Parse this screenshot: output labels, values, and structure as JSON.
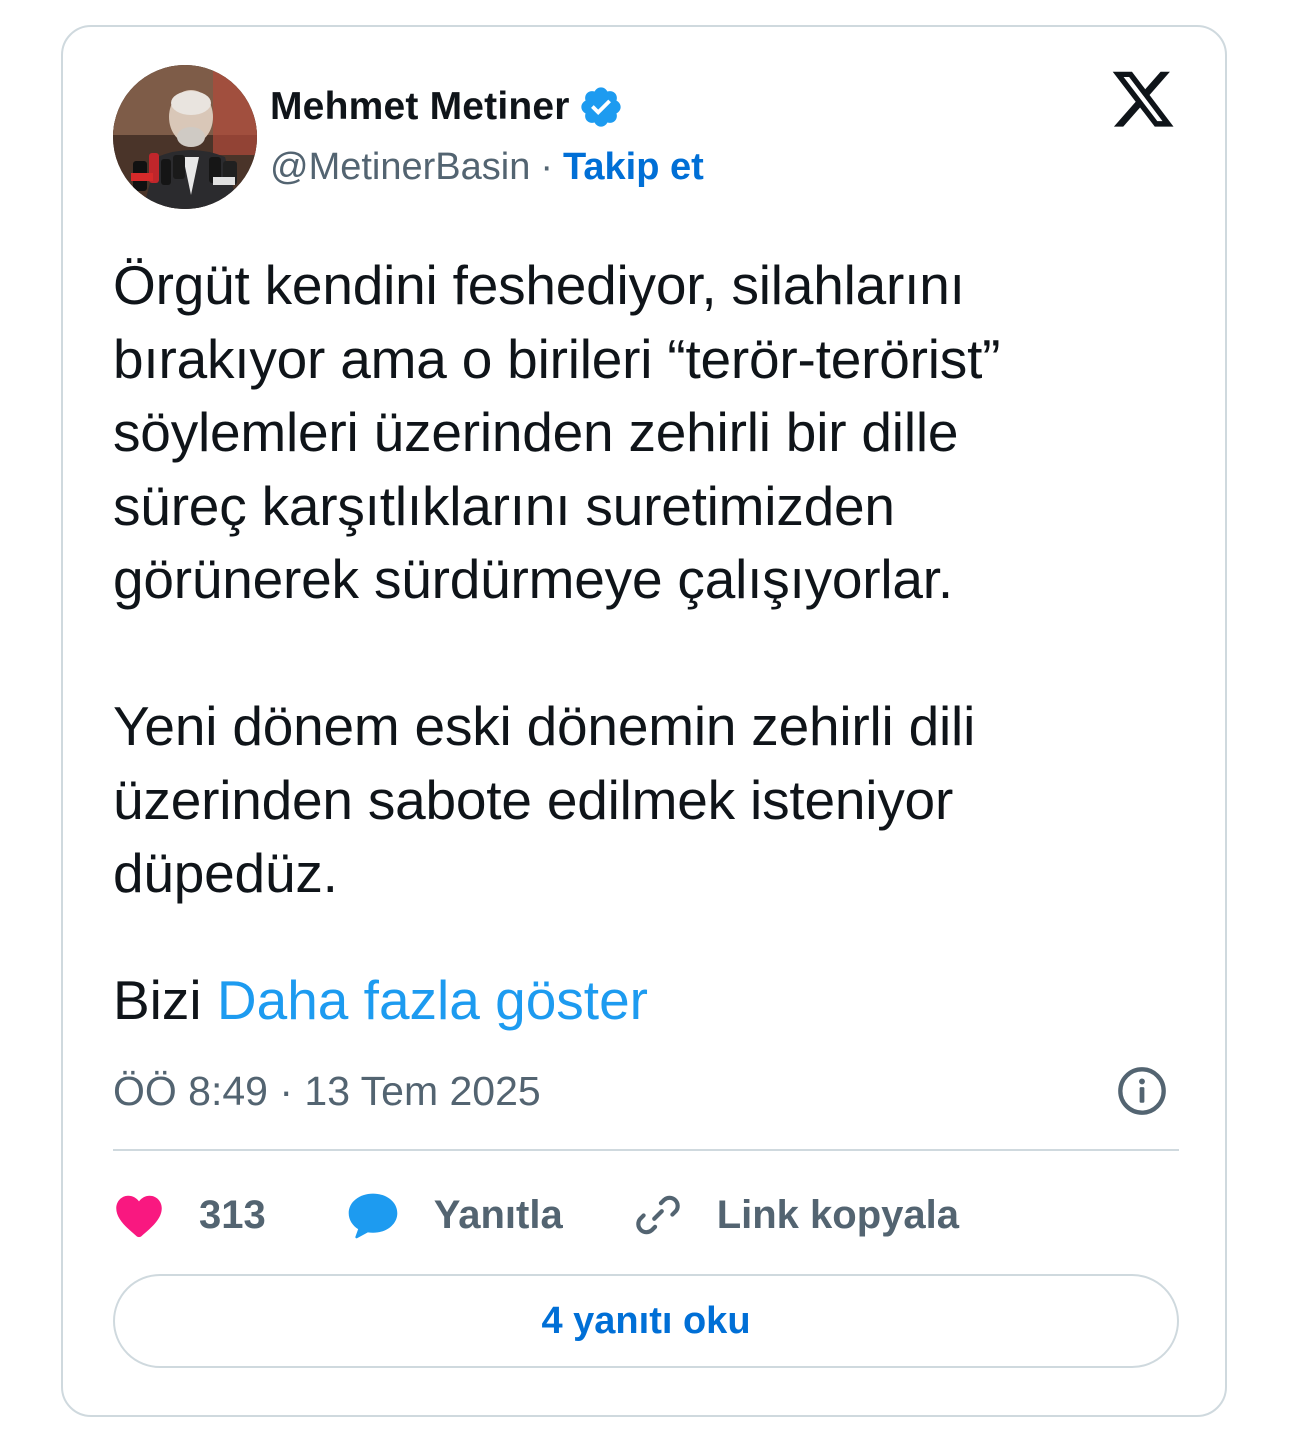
{
  "author": {
    "display_name": "Mehmet Metiner",
    "handle": "@MetinerBasin",
    "separator": "·",
    "follow_label": "Takip et",
    "verified": true,
    "avatar_icon": "profile-photo"
  },
  "platform": {
    "logo_icon": "x-logo-icon"
  },
  "tweet": {
    "text": "Örgüt kendini feshediyor, silahlarını\nbırakıyor ama o birileri “terör-terörist”\nsöylemleri üzerinden zehirli bir dille\nsüreç karşıtlıklarını suretimizden\ngörünerek sürdürmeye çalışıyorlar.\n\nYeni dönem eski dönemin zehirli dili\nüzerinden sabote edilmek isteniyor\ndüpedüz.",
    "truncated_prefix": "Bizi",
    "show_more_label": "Daha fazla göster",
    "timestamp": "ÖÖ 8:49 · 13 Tem 2025"
  },
  "actions": {
    "like_count": "313",
    "reply_label": "Yanıtla",
    "copy_link_label": "Link kopyala"
  },
  "footer": {
    "read_replies_label": "4 yanıtı oku"
  },
  "colors": {
    "like": "#f91880",
    "reply": "#1d9bf0",
    "link": "#006fd6",
    "show_more": "#1d9bf0",
    "verified": "#1d9bf0",
    "muted": "#536471",
    "border": "#cfd9de"
  }
}
